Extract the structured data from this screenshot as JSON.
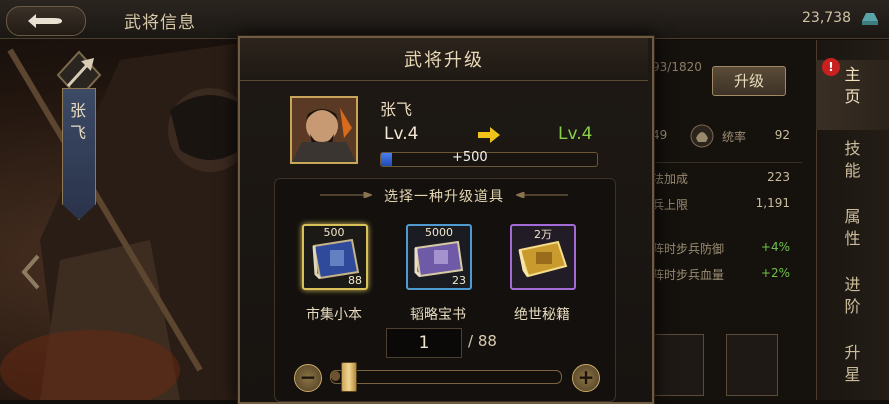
{
  "topbar": {
    "title": "武将信息",
    "gold": "23,738",
    "back_icon": "return-arrow-icon",
    "gold_icon": "gold-ingot-icon"
  },
  "hero_banner": {
    "name_vertical": "张\n飞"
  },
  "right_panel": {
    "exp_text": "93/1820",
    "upgrade_label": "升级",
    "stat_left_value": "49",
    "command_label": "统率",
    "command_value": "92",
    "rows": [
      {
        "label": "法加成",
        "value": "223",
        "green": false
      },
      {
        "label": "兵上限",
        "value": "1,191",
        "green": false
      },
      {
        "label": "阵时步兵防御",
        "value": "+4%",
        "green": true
      },
      {
        "label": "阵时步兵血量",
        "value": "+2%",
        "green": true
      }
    ]
  },
  "tabs": [
    {
      "label": "主\n页",
      "active": true
    },
    {
      "label": "技\n能",
      "active": false
    },
    {
      "label": "属\n性",
      "active": false
    },
    {
      "label": "进\n阶",
      "active": false
    },
    {
      "label": "升\n星",
      "active": false
    }
  ],
  "alert_badge": "!",
  "modal": {
    "title": "武将升级",
    "hero_name": "张飞",
    "level_from": "Lv.4",
    "level_to": "Lv.4",
    "xp_gain": "+500",
    "xp_progress": 0.05,
    "section_title": "选择一种升级道具",
    "items": [
      {
        "name": "市集小本",
        "price": "500",
        "count": "88",
        "color": "#2f4a9a",
        "frame": "#d9c15a",
        "selected": true
      },
      {
        "name": "韬略宝书",
        "price": "5000",
        "count": "23",
        "color": "#6f5aa8",
        "frame": "#4f9bd0",
        "selected": false
      },
      {
        "name": "绝世秘籍",
        "price": "2万",
        "count": "",
        "color": "#c99a2e",
        "frame": "#a36bd6",
        "selected": false
      }
    ],
    "quantity": "1",
    "quantity_max": "/ 88",
    "slider_fraction": 0.04,
    "minus_label": "−",
    "plus_label": "+"
  }
}
